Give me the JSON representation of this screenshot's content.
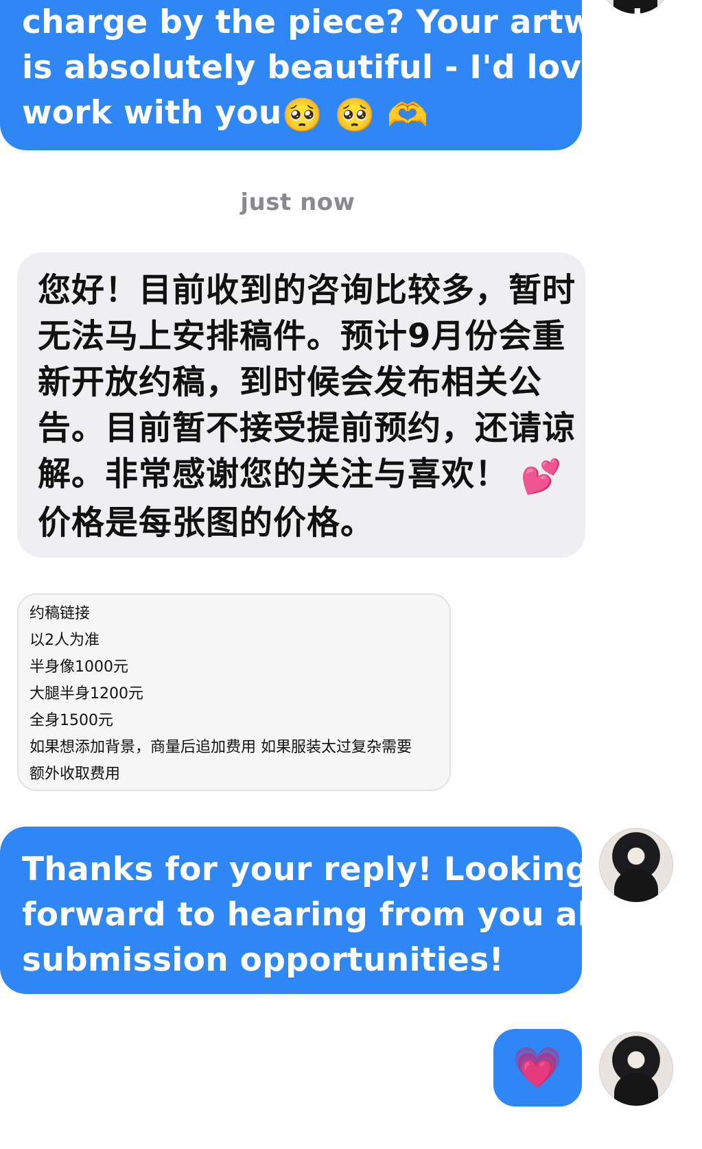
{
  "messages": [
    {
      "id": "msg-1",
      "direction": "outgoing",
      "lines": [
        "charge by the piece? Your artwork",
        "is absolutely beautiful - I'd love to",
        "work with you"
      ],
      "emojis": [
        "🥺",
        "🥺",
        "🫶"
      ]
    },
    {
      "id": "msg-2",
      "direction": "incoming",
      "lines": [
        "您好！目前收到的咨询比较多，暂时",
        "无法马上安排稿件。预计9月份会重",
        "新开放约稿，到时候会发布相关公",
        "告。目前暂不接受提前预约，还请谅",
        "解。非常感谢您的关注与喜欢！",
        "价格是每张图的价格。"
      ],
      "emoji": "💕"
    },
    {
      "id": "card",
      "direction": "incoming",
      "rows": [
        "约稿链接",
        "以2人为准",
        " 半身像1000元",
        "大腿半身1200元",
        "全身1500元",
        "如果想添加背景，商量后追加费用 如果服装太过复杂需要",
        "额外收取费用"
      ]
    },
    {
      "id": "msg-3",
      "direction": "outgoing",
      "lines": [
        "Thanks for your reply! Looking",
        "forward to hearing from you about",
        "submission opportunities!"
      ]
    },
    {
      "id": "msg-4",
      "direction": "outgoing",
      "emoji": "💗"
    }
  ],
  "timestamp": "just now",
  "colors": {
    "outgoing_bubble": "#2f86f5",
    "incoming_bubble": "#efeff1",
    "timestamp_text": "#8a8a8e"
  }
}
